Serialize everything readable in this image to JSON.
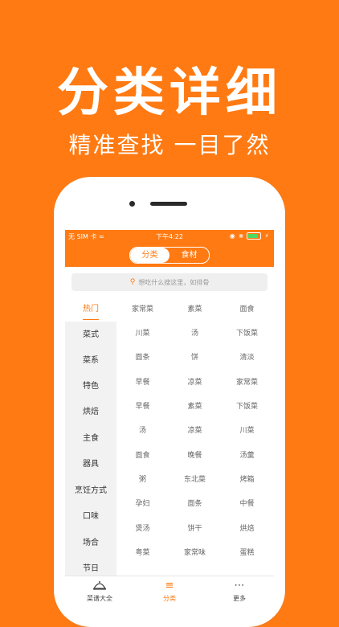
{
  "promo": {
    "title": "分类详细",
    "subtitle": "精准查找 一目了然"
  },
  "statusbar": {
    "carrier": "无 SIM 卡",
    "time": "下午4:22"
  },
  "segment": {
    "tabs": [
      "分类",
      "食材"
    ],
    "active_index": 0
  },
  "search": {
    "placeholder": "想吃什么搜这里，如排骨"
  },
  "sidebar": {
    "items": [
      "热门",
      "菜式",
      "菜系",
      "特色",
      "烘焙",
      "主食",
      "器具",
      "烹饪方式",
      "口味",
      "场合",
      "节日"
    ],
    "active_index": 0
  },
  "grid": {
    "rows": [
      [
        "家常菜",
        "素菜",
        "面食"
      ],
      [
        "川菜",
        "汤",
        "下饭菜"
      ],
      [
        "面条",
        "饼",
        "清淡"
      ],
      [
        "早餐",
        "凉菜",
        "家常菜"
      ],
      [
        "早餐",
        "素菜",
        "下饭菜"
      ],
      [
        "汤",
        "凉菜",
        "川菜"
      ],
      [
        "面食",
        "晚餐",
        "汤羹"
      ],
      [
        "粥",
        "东北菜",
        "烤箱"
      ],
      [
        "孕妇",
        "面条",
        "中餐"
      ],
      [
        "煲汤",
        "饼干",
        "烘焙"
      ],
      [
        "粤菜",
        "家常味",
        "蛋糕"
      ]
    ]
  },
  "tabbar": {
    "items": [
      {
        "label": "菜谱大全",
        "icon": "cloche-icon"
      },
      {
        "label": "分类",
        "icon": "list-icon"
      },
      {
        "label": "更多",
        "icon": "more-icon"
      }
    ],
    "active_index": 1
  },
  "colors": {
    "accent": "#ff7a12",
    "sidebar_bg": "#f2f2f2"
  }
}
